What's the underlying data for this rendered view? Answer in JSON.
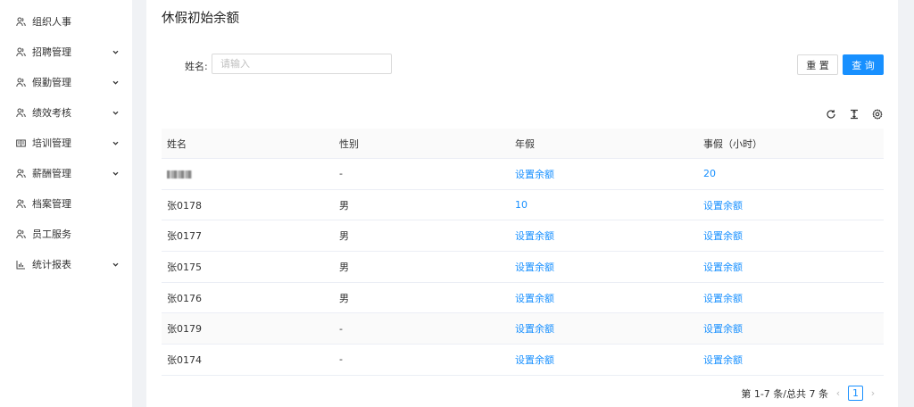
{
  "sidebar": {
    "items": [
      {
        "label": "组织人事",
        "icon": "users-icon",
        "expandable": false
      },
      {
        "label": "招聘管理",
        "icon": "users-icon",
        "expandable": true
      },
      {
        "label": "假勤管理",
        "icon": "users-icon",
        "expandable": true
      },
      {
        "label": "绩效考核",
        "icon": "users-icon",
        "expandable": true
      },
      {
        "label": "培训管理",
        "icon": "book-icon",
        "expandable": true
      },
      {
        "label": "薪酬管理",
        "icon": "users-icon",
        "expandable": true
      },
      {
        "label": "档案管理",
        "icon": "users-icon",
        "expandable": false
      },
      {
        "label": "员工服务",
        "icon": "users-icon",
        "expandable": false
      },
      {
        "label": "统计报表",
        "icon": "bar-chart-icon",
        "expandable": true
      }
    ]
  },
  "page": {
    "title": "休假初始余额"
  },
  "search": {
    "label": "姓名:",
    "placeholder": "请输入",
    "value": ""
  },
  "buttons": {
    "reset": "重 置",
    "query": "查 询"
  },
  "toolbar": {
    "icons": [
      "reload-icon",
      "column-height-icon",
      "settings-icon"
    ]
  },
  "table": {
    "columns": [
      "姓名",
      "性别",
      "年假",
      "事假（小时）"
    ],
    "rows": [
      {
        "name": "",
        "name_blurred": true,
        "gender": "-",
        "annual": "设置余额",
        "personal": "20"
      },
      {
        "name": "张0178",
        "gender": "男",
        "annual": "10",
        "personal": "设置余额"
      },
      {
        "name": "张0177",
        "gender": "男",
        "annual": "设置余额",
        "personal": "设置余额"
      },
      {
        "name": "张0175",
        "gender": "男",
        "annual": "设置余额",
        "personal": "设置余额"
      },
      {
        "name": "张0176",
        "gender": "男",
        "annual": "设置余额",
        "personal": "设置余额"
      },
      {
        "name": "张0179",
        "gender": "-",
        "annual": "设置余额",
        "personal": "设置余额",
        "highlight": true
      },
      {
        "name": "张0174",
        "gender": "-",
        "annual": "设置余额",
        "personal": "设置余额"
      }
    ]
  },
  "pagination": {
    "summary": "第 1-7 条/总共 7 条",
    "current": "1",
    "prev": "‹",
    "next": "›"
  },
  "colors": {
    "accent": "#1890ff",
    "border": "#d9d9d9",
    "header_bg": "#fafafa"
  }
}
